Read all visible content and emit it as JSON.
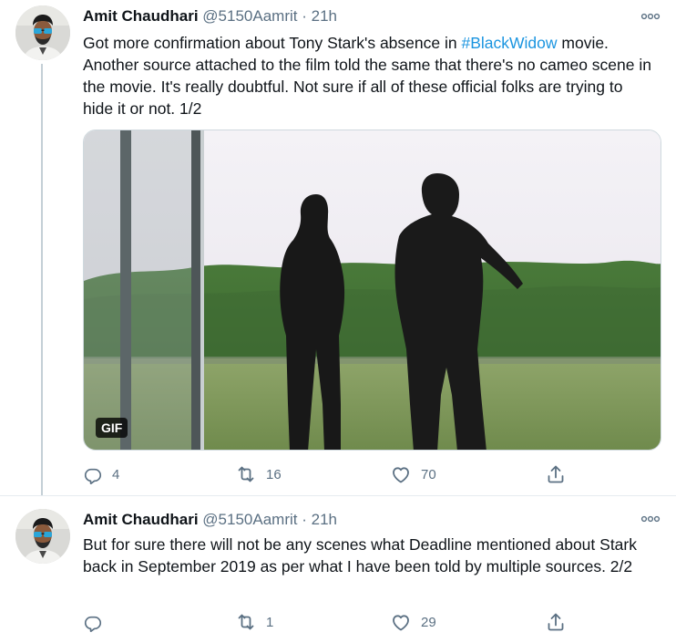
{
  "colors": {
    "accent": "#1b95e0",
    "muted": "#5b7083",
    "divider": "#e6ecf0",
    "thread_line": "#c4cfd6"
  },
  "tweets": [
    {
      "author_name": "Amit Chaudhari",
      "handle": "@5150Aamrit",
      "separator": "·",
      "time": "21h",
      "text_before": "Got more confirmation about Tony Stark's absence in ",
      "hashtag": "#BlackWidow",
      "text_after": " movie. Another source attached to the film told the same that there's no cameo scene in the movie. It's really doubtful. Not sure if all of these official folks are trying to hide it or not. 1/2",
      "media_badge": "GIF",
      "reply_count": "4",
      "retweet_count": "16",
      "like_count": "70",
      "icons": [
        "more-icon",
        "reply-icon",
        "retweet-icon",
        "like-icon",
        "share-icon"
      ]
    },
    {
      "author_name": "Amit Chaudhari",
      "handle": "@5150Aamrit",
      "separator": "·",
      "time": "21h",
      "text": "But for sure there will not be any scenes what Deadline mentioned about Stark back in September 2019 as per what I have been told by multiple sources. 2/2",
      "reply_count": "",
      "retweet_count": "1",
      "like_count": "29",
      "icons": [
        "more-icon",
        "reply-icon",
        "retweet-icon",
        "like-icon",
        "share-icon"
      ]
    }
  ]
}
